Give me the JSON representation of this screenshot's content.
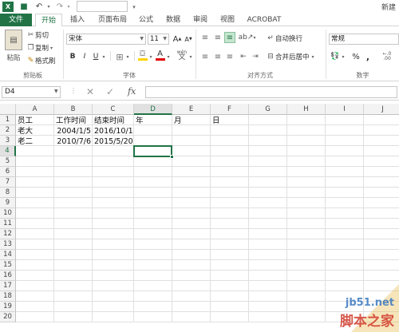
{
  "title_bar": {
    "right_text": "新建"
  },
  "tabs": [
    "文件",
    "开始",
    "插入",
    "页面布局",
    "公式",
    "数据",
    "审阅",
    "视图",
    "ACROBAT"
  ],
  "ribbon": {
    "clipboard": {
      "paste": "粘贴",
      "cut": "剪切",
      "copy": "复制",
      "format_painter": "格式刷",
      "group_label": "剪贴板"
    },
    "font": {
      "font_name": "宋体",
      "font_size": "11",
      "grow": "A",
      "shrink": "A",
      "bold": "B",
      "italic": "I",
      "underline": "U",
      "font_color": "A",
      "wen": "wén",
      "group_label": "字体"
    },
    "alignment": {
      "wrap_text": "自动换行",
      "merge_center": "合并后居中",
      "group_label": "对齐方式"
    },
    "number": {
      "format": "常规",
      "percent": "%",
      "comma": ",",
      "group_label": "数字"
    },
    "colors": {
      "accent": "#217346",
      "fill_yellow": "#ffd200",
      "font_red": "#e00000"
    }
  },
  "formula_bar": {
    "name_box": "D4",
    "fx": "fx",
    "cancel": "✕",
    "enter": "✓",
    "formula": ""
  },
  "sheet": {
    "columns": [
      "A",
      "B",
      "C",
      "D",
      "E",
      "F",
      "G",
      "H",
      "I",
      "J"
    ],
    "rows": [
      "1",
      "2",
      "3",
      "4",
      "5",
      "6",
      "7",
      "8",
      "9",
      "10",
      "11",
      "12",
      "13",
      "14",
      "15",
      "16",
      "17",
      "18",
      "19",
      "20"
    ],
    "selected_cell": "D4",
    "cells": {
      "A1": "员工",
      "B1": "工作时间",
      "C1": "结束时间",
      "D1": "年",
      "E1": "月",
      "F1": "日",
      "A2": "老大",
      "B2": "2004/1/5",
      "C2": "2016/10/1",
      "A3": "老二",
      "B3": "2010/7/6",
      "C3": "2015/5/20"
    }
  },
  "watermark": {
    "url": "jb51.net",
    "brand": "脚本之家"
  }
}
